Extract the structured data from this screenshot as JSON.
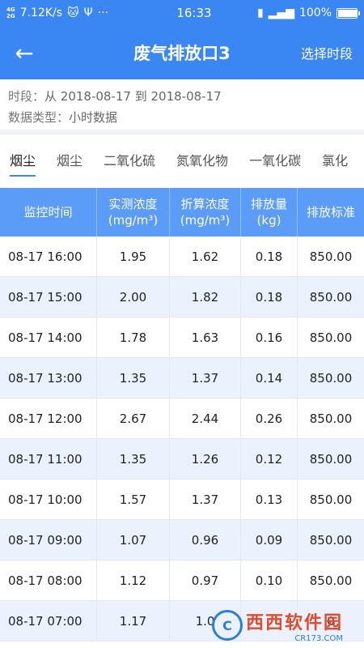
{
  "status": {
    "network": [
      "4G",
      "2G"
    ],
    "speed": "7.12K/s",
    "time": "16:33",
    "battery": "100%",
    "battery_level": 1.0
  },
  "nav": {
    "title": "废气排放口3",
    "action": "选择时段"
  },
  "info": {
    "period_label": "时段：",
    "period_value": "从 2018-08-17 到 2018-08-17",
    "type_label": "数据类型：",
    "type_value": "小时数据"
  },
  "tabs": [
    "烟尘",
    "烟尘",
    "二氧化硫",
    "氮氧化物",
    "一氧化碳",
    "氯化"
  ],
  "table": {
    "headers": [
      [
        "监控时间"
      ],
      [
        "实测浓度",
        "(mg/m³)"
      ],
      [
        "折算浓度",
        "(mg/m³)"
      ],
      [
        "排放量",
        "(kg)"
      ],
      [
        "排放标准"
      ]
    ],
    "rows": [
      [
        "08-17 16:00",
        "1.95",
        "1.62",
        "0.18",
        "850.00"
      ],
      [
        "08-17 15:00",
        "2.00",
        "1.82",
        "0.18",
        "850.00"
      ],
      [
        "08-17 14:00",
        "1.78",
        "1.63",
        "0.16",
        "850.00"
      ],
      [
        "08-17 13:00",
        "1.35",
        "1.37",
        "0.14",
        "850.00"
      ],
      [
        "08-17 12:00",
        "2.67",
        "2.44",
        "0.26",
        "850.00"
      ],
      [
        "08-17 11:00",
        "1.35",
        "1.26",
        "0.12",
        "850.00"
      ],
      [
        "08-17 10:00",
        "1.57",
        "1.37",
        "0.13",
        "850.00"
      ],
      [
        "08-17 09:00",
        "1.07",
        "0.96",
        "0.09",
        "850.00"
      ],
      [
        "08-17 08:00",
        "1.12",
        "0.97",
        "0.10",
        "850.00"
      ],
      [
        "08-17 07:00",
        "1.17",
        "1.0",
        "",
        "0"
      ]
    ]
  },
  "watermark": {
    "main": "西西软件园",
    "sub": "CR173.COM",
    "glyph": "C"
  },
  "colors": {
    "brand": "#3a86f2",
    "table_header": "#5a9cf8",
    "row_stripe": "#ebf2fe"
  }
}
